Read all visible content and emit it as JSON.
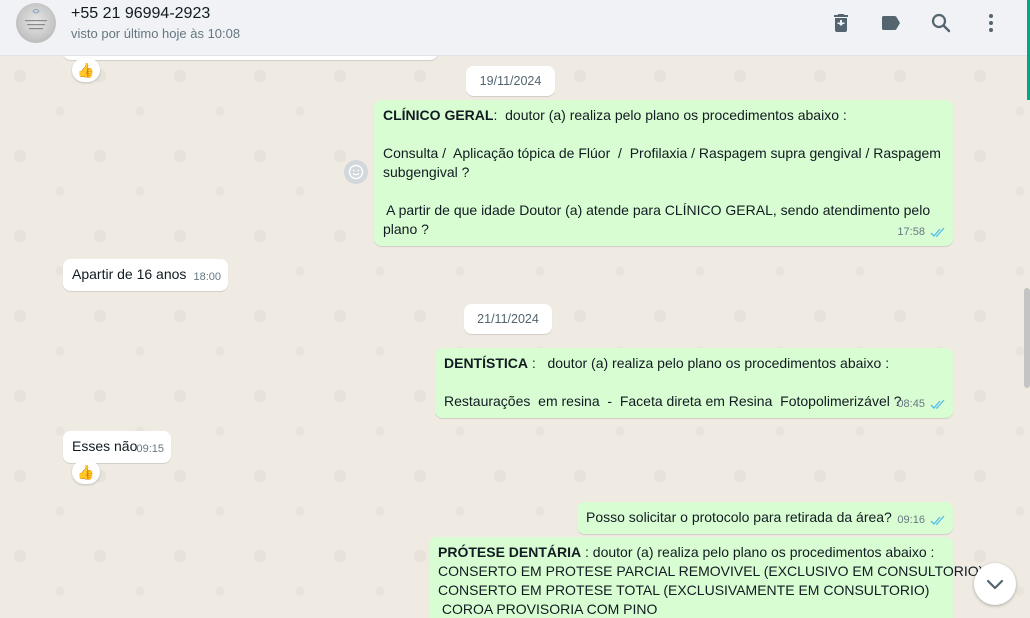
{
  "header": {
    "contact_name": "+55 21 96994-2923",
    "status": "visto por último hoje às 10:08",
    "icons": [
      "delete-icon",
      "label-icon",
      "search-icon",
      "menu-icon"
    ]
  },
  "chat": {
    "reaction_top": "👍",
    "date_1": "19/11/2024",
    "msg1": {
      "title": "CLÍNICO GERAL",
      "title_rest": ":  doutor (a) realiza pelo plano os procedimentos abaixo :",
      "line2": "Consulta /  Aplicação tópica de Flúor  /  Profilaxia / Raspagem supra gengival / Raspagem",
      "line3": "subgengival ?",
      "line4": " A partir de que idade Doutor (a) atende para CLÍNICO GERAL, sendo atendimento pelo",
      "line5": "plano ?",
      "time": "17:58"
    },
    "msg2": {
      "text": "Apartir de 16 anos",
      "time": "18:00"
    },
    "date_2": "21/11/2024",
    "msg3": {
      "title": "DENTÍSTICA",
      "title_rest": " :   doutor (a) realiza pelo plano os procedimentos abaixo :",
      "line2": "Restaurações  em resina  -  Faceta direta em Resina  Fotopolimerizável ?",
      "time": "08:45"
    },
    "msg4": {
      "text": "Esses não",
      "time": "09:15",
      "reaction": "👍"
    },
    "msg5": {
      "text": "Posso solicitar o protocolo para retirada da área?",
      "time": "09:16"
    },
    "msg6": {
      "title": "PRÓTESE DENTÁRIA",
      "title_rest": " : doutor (a) realiza pelo plano os procedimentos abaixo :",
      "line2": "CONSERTO EM PROTESE PARCIAL REMOVIVEL (EXCLUSIVO EM CONSULTORIO)",
      "line3": "CONSERTO EM PROTESE TOTAL (EXCLUSIVAMENTE EM CONSULTORIO)",
      "line4": " COROA PROVISORIA COM PINO"
    }
  },
  "colors": {
    "outgoing": "#d9fdd3",
    "incoming": "#ffffff",
    "read_ticks": "#53bdeb",
    "background": "#efeae2"
  }
}
